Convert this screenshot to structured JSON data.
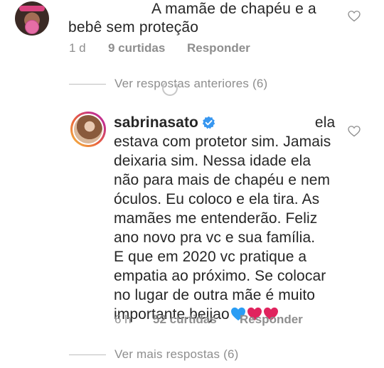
{
  "comment": {
    "line1": "A mamãe de chapéu e a",
    "line2": "bebê sem proteção",
    "time": "1 d",
    "likes": "9 curtidas",
    "reply_label": "Responder"
  },
  "view_previous": "Ver respostas anteriores (6)",
  "reply": {
    "username": "sabrinasato",
    "lines": [
      "ela",
      "estava com protetor sim. Jamais",
      "deixaria sim. Nessa idade ela",
      "não para mais de chapéu e nem",
      "óculos. Eu coloco e ela tira. As",
      "mamães me entenderão. Feliz",
      "ano novo pra vc e sua família.",
      "E que em 2020 vc pratique a",
      "empatia ao próximo. Se colocar",
      "no lugar de outra mãe é muito",
      "importante.beijao"
    ],
    "emojis": [
      "💙",
      "❤️",
      "❤️"
    ],
    "time": "6 h",
    "likes": "52 curtidas",
    "reply_label": "Responder"
  },
  "view_more": "Ver mais respostas (6)",
  "colors": {
    "text": "#262626",
    "muted": "#8e8e8e",
    "verified": "#3897f0",
    "blue_heart": "#2a9df4",
    "red_heart": "#e0245e"
  },
  "icons": [
    "heart-outline-icon",
    "verified-badge-icon",
    "loading-spinner-icon"
  ]
}
